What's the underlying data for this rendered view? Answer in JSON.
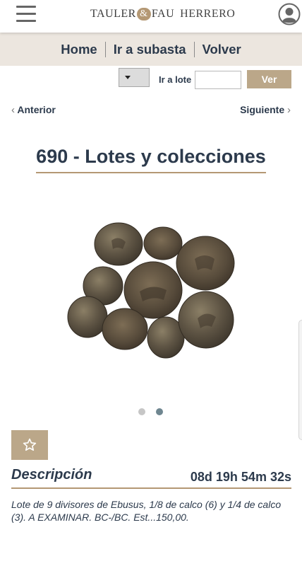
{
  "header": {
    "brand_left": "TAULER",
    "brand_amp": "&",
    "brand_mid": "FAU",
    "brand_right": "HERRERO",
    "menu_icon": "hamburger-menu-icon",
    "user_icon": "user-account-icon"
  },
  "nav": {
    "home": "Home",
    "auction": "Ir a subasta",
    "back": "Volver"
  },
  "lot_nav": {
    "goto_label": "Ir a lote",
    "goto_value": "",
    "go_button": "Ver"
  },
  "pager": {
    "prev": "Anterior",
    "next": "Siguiente"
  },
  "lot": {
    "title": "690 - Lotes y colecciones",
    "image_count": 2,
    "active_image": 2
  },
  "description": {
    "heading": "Descripción",
    "countdown": "08d 19h 54m 32s",
    "text": "Lote de 9 divisores de Ebusus, 1/8 de calco (6) y 1/4 de calco (3).  A EXAMINAR. BC-/BC. Est...150,00."
  },
  "colors": {
    "accent": "#bba789",
    "nav_bg": "#ece6df",
    "text": "#2c3a4c",
    "dot_active": "#6f8690"
  }
}
